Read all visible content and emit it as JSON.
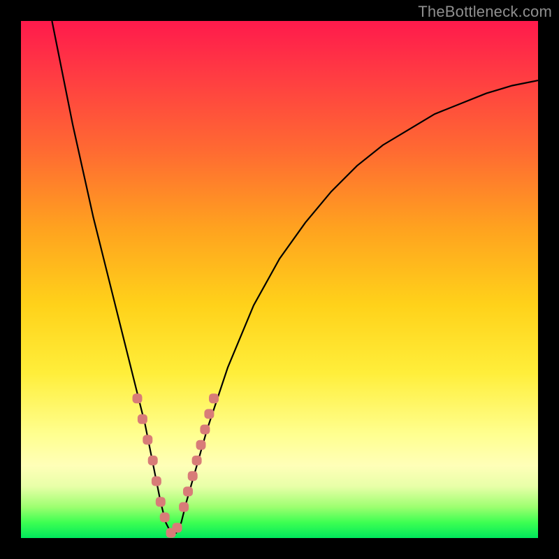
{
  "watermark": "TheBottleneck.com",
  "colors": {
    "background": "#000000",
    "curve": "#000000",
    "marker": "#d87c78",
    "gradient_top": "#ff1a4c",
    "gradient_bottom": "#00e85c"
  },
  "chart_data": {
    "type": "line",
    "title": "",
    "xlabel": "",
    "ylabel": "",
    "xlim": [
      0,
      100
    ],
    "ylim": [
      0,
      100
    ],
    "note": "Axes are unlabeled; values are normalized 0-100 estimated from pixel positions. y=100 corresponds to the top (red, high bottleneck), y=0 to the bottom (green, no bottleneck). The curve is a V-shaped bottleneck profile with minimum near x≈29.",
    "series": [
      {
        "name": "bottleneck-curve",
        "x": [
          6,
          8,
          10,
          12,
          14,
          16,
          18,
          20,
          22,
          24,
          26,
          27,
          28,
          29,
          30,
          31,
          32,
          34,
          36,
          40,
          45,
          50,
          55,
          60,
          65,
          70,
          75,
          80,
          85,
          90,
          95,
          100
        ],
        "y": [
          100,
          90,
          80,
          71,
          62,
          54,
          46,
          38,
          30,
          22,
          12,
          7,
          3,
          1,
          1,
          3,
          7,
          14,
          21,
          33,
          45,
          54,
          61,
          67,
          72,
          76,
          79,
          82,
          84,
          86,
          87.5,
          88.5
        ]
      }
    ],
    "markers": {
      "name": "highlighted-points",
      "x": [
        22.5,
        23.5,
        24.5,
        25.5,
        26.2,
        27.0,
        27.8,
        29.0,
        30.2,
        31.5,
        32.3,
        33.2,
        34.0,
        34.8,
        35.6,
        36.4,
        37.3
      ],
      "y": [
        27,
        23,
        19,
        15,
        11,
        7,
        4,
        1,
        2,
        6,
        9,
        12,
        15,
        18,
        21,
        24,
        27
      ]
    }
  }
}
